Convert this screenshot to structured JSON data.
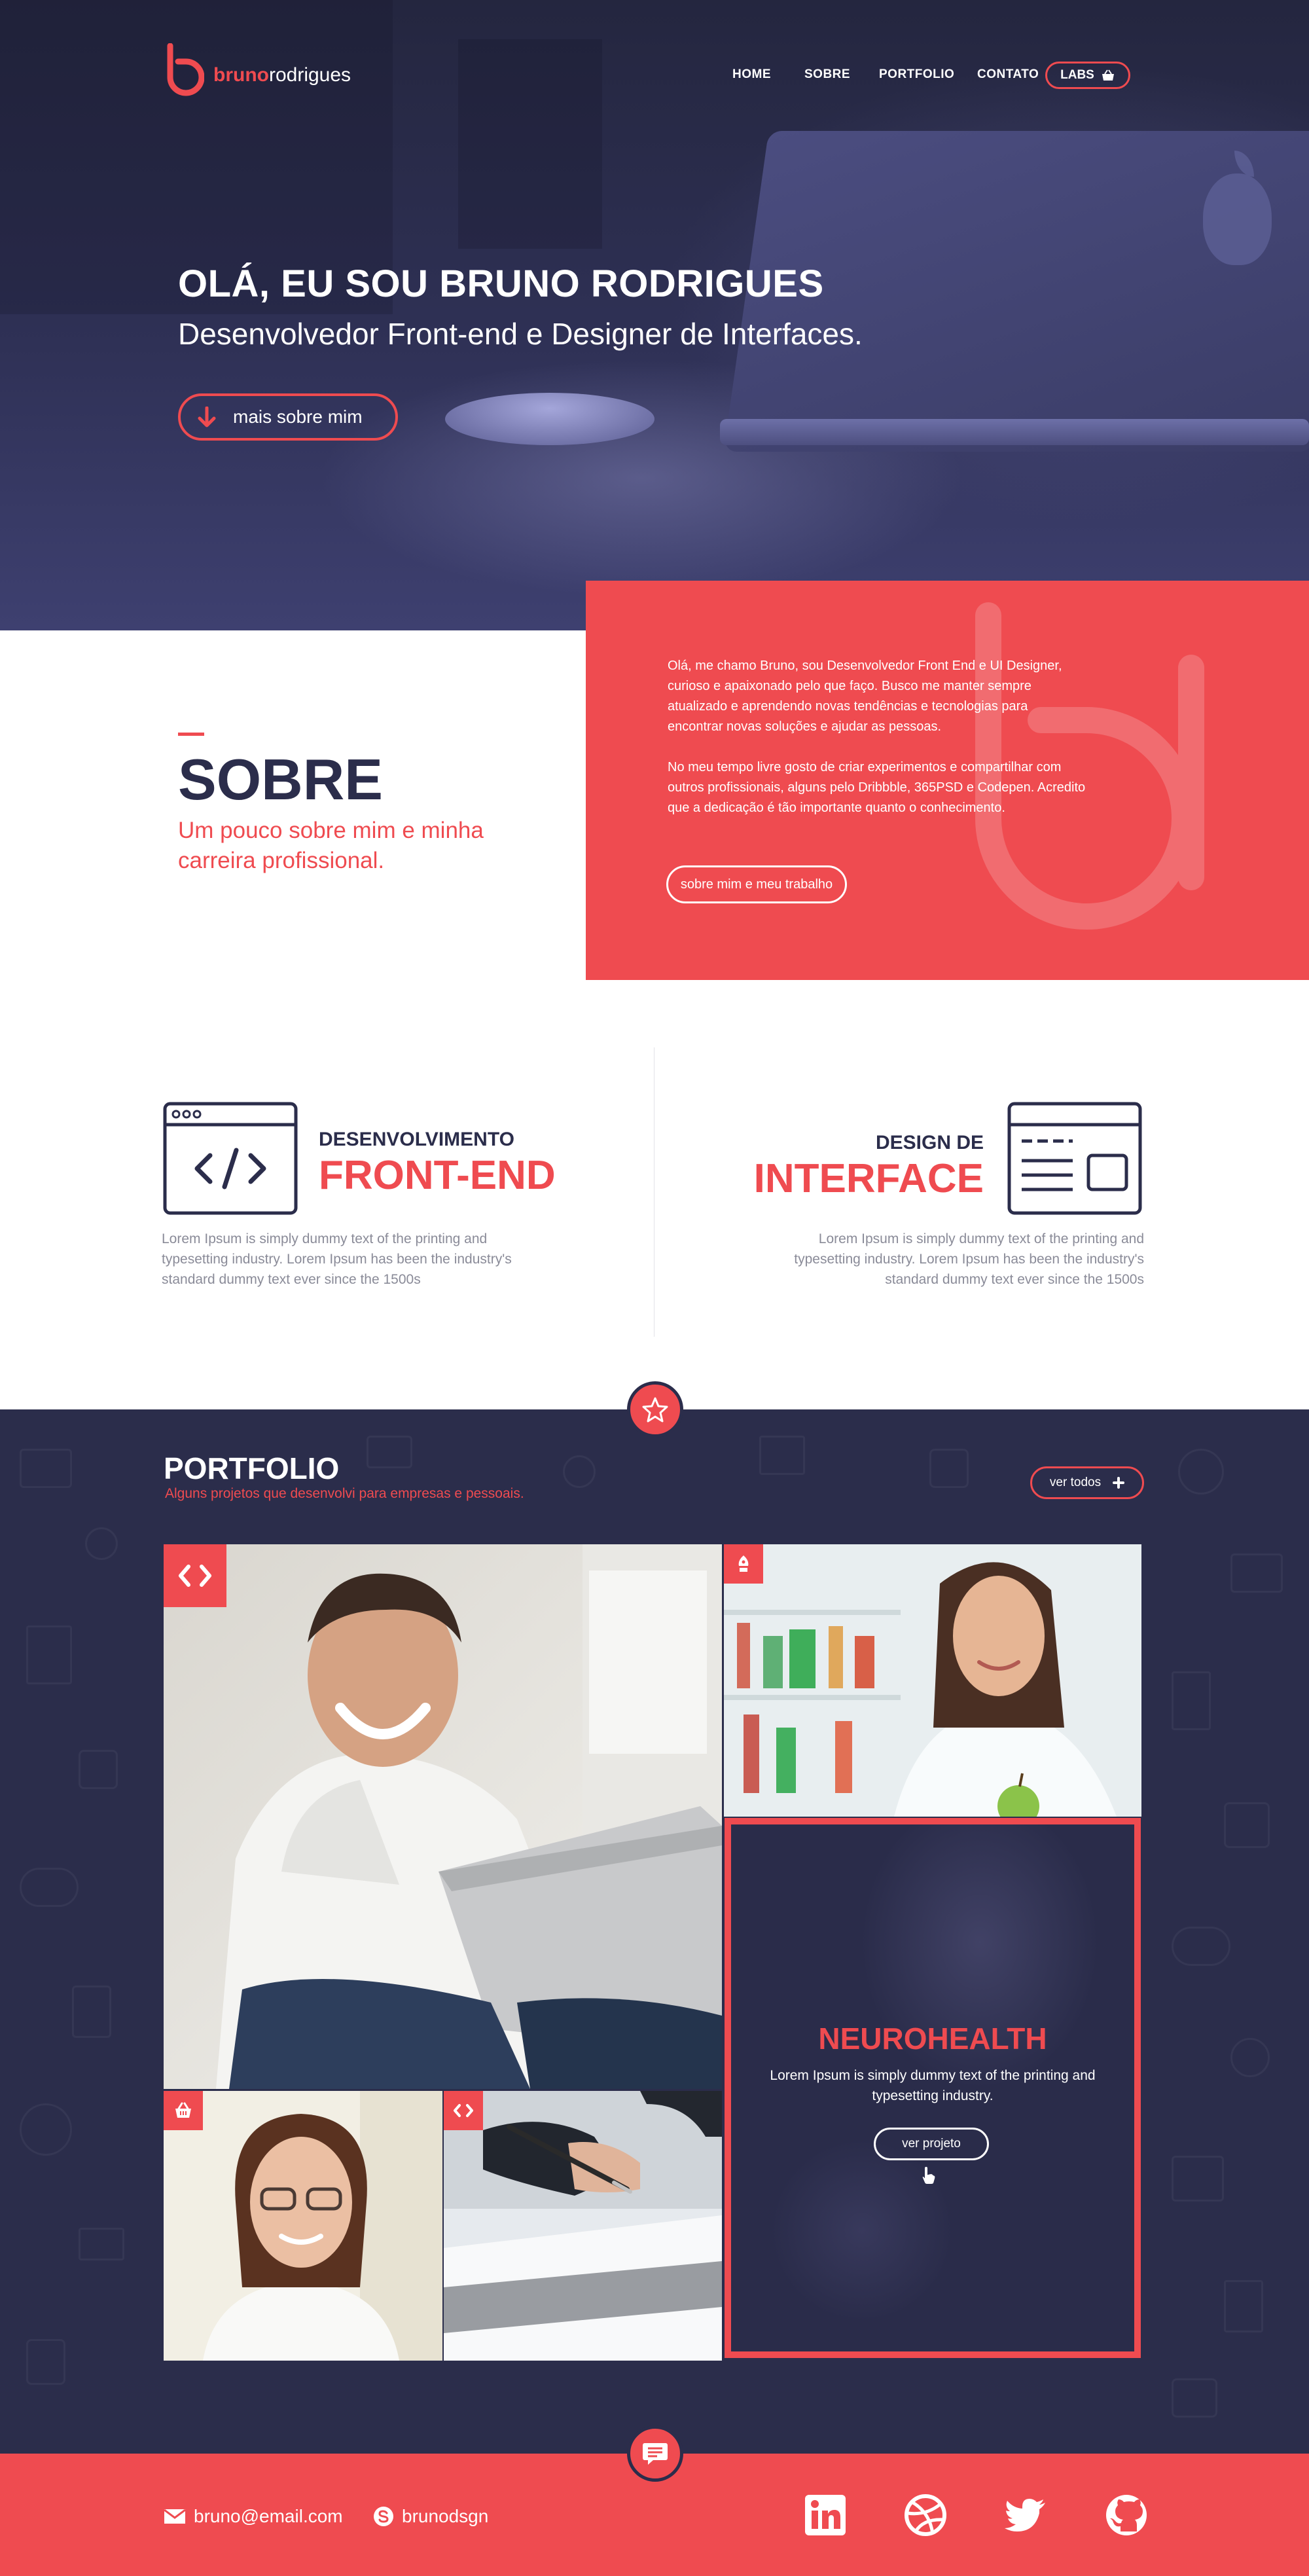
{
  "header": {
    "logo": {
      "bold": "bruno",
      "light": "rodrigues",
      "icon": "b-logo-icon"
    },
    "nav": [
      "HOME",
      "SOBRE",
      "PORTFOLIO",
      "CONTATO"
    ],
    "labs_label": "LABS"
  },
  "hero": {
    "title": "OLÁ, EU SOU BRUNO RODRIGUES",
    "subtitle": "Desenvolvedor Front-end e Designer de Interfaces.",
    "button_label": "mais sobre mim"
  },
  "sobre": {
    "title": "SOBRE",
    "subtitle": "Um pouco sobre mim e minha carreira profissional.",
    "paragraph_1": "Olá, me chamo Bruno, sou Desenvolvedor Front End e UI Designer, curioso e apaixonado pelo que faço. Busco me manter sempre atualizado e aprendendo novas tendências e tecnologias para encontrar novas soluções e ajudar as pessoas.",
    "paragraph_2": "No meu tempo livre gosto de criar experimentos e compartilhar com outros profissionais, alguns pelo Dribbble, 365PSD e Codepen. Acredito que a dedicação é tão importante quanto o conhecimento.",
    "button_label": "sobre mim e meu trabalho"
  },
  "services": [
    {
      "small": "DESENVOLVIMENTO",
      "big": "FRONT-END",
      "desc": "Lorem Ipsum is simply dummy text of the printing and typesetting industry. Lorem Ipsum has been the industry's standard dummy text ever since the 1500s",
      "icon": "code-window-icon"
    },
    {
      "small": "DESIGN DE",
      "big": "INTERFACE",
      "desc": "Lorem Ipsum is simply dummy text of the printing and typesetting industry. Lorem Ipsum has been the industry's standard dummy text ever since the 1500s",
      "icon": "layout-window-icon"
    }
  ],
  "portfolio": {
    "title": "PORTFOLIO",
    "subtitle": "Alguns projetos que desenvolvi para empresas e pessoais.",
    "ver_todos_label": "ver todos",
    "featured": {
      "title": "NEUROHEALTH",
      "desc": "Lorem Ipsum is simply dummy text of the printing and typesetting industry.",
      "button_label": "ver projeto"
    },
    "tiles": [
      {
        "badge_icon": "code-icon",
        "photo": "man-with-laptop-photo"
      },
      {
        "badge_icon": "pen-icon",
        "photo": "female-doctor-photo"
      },
      {
        "badge_icon": "basket-icon",
        "photo": "woman-with-glasses-photo"
      },
      {
        "badge_icon": "code-icon",
        "photo": "hand-signing-document-photo"
      }
    ]
  },
  "footer": {
    "email": "bruno@email.com",
    "skype": "brunodsgn",
    "social": [
      "linkedin-icon",
      "dribbble-icon",
      "twitter-icon",
      "github-icon"
    ]
  },
  "colors": {
    "accent": "#ef4b50",
    "navy": "#2b2d4b",
    "white": "#ffffff",
    "muted_text": "#8a8b98"
  }
}
